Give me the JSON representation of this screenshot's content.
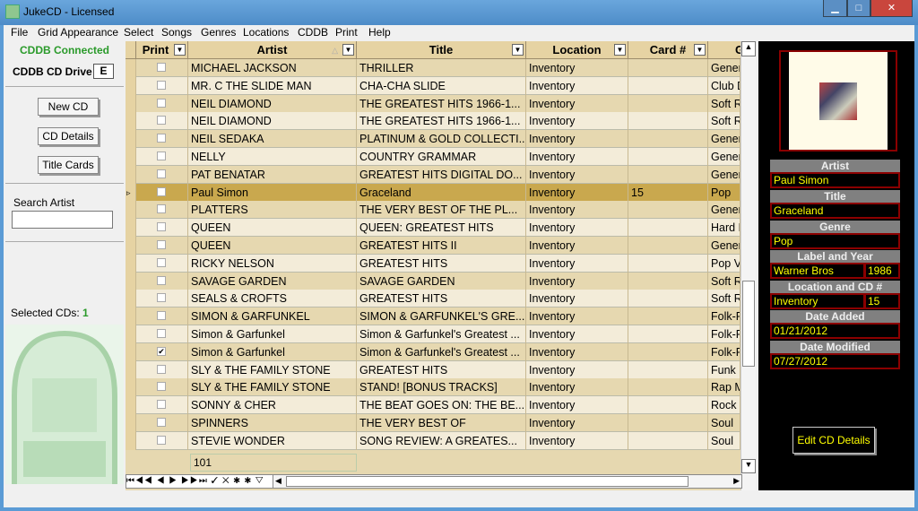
{
  "window": {
    "title": "JukeCD - Licensed",
    "min": "▁",
    "max": "□",
    "close": "✕"
  },
  "menu": [
    "File",
    "Grid Appearance",
    "Select",
    "Songs",
    "Genres",
    "Locations",
    "CDDB",
    "Print",
    "Help"
  ],
  "left": {
    "cddb_status": "CDDB Connected",
    "cd_drive_label": "CDDB CD Drive",
    "cd_drive_value": "E",
    "new_cd": "New CD",
    "cd_details": "CD Details",
    "title_cards": "Title Cards",
    "search_label": "Search Artist",
    "search_value": "",
    "selected_label": "Selected CDs:",
    "selected_count": "1"
  },
  "grid": {
    "columns": [
      "Print",
      "Artist",
      "Title",
      "Location",
      "Card #",
      "G"
    ],
    "rows": [
      {
        "print": false,
        "artist": "MICHAEL JACKSON",
        "title": "THRILLER",
        "location": "Inventory",
        "card": "",
        "genre": "Gener"
      },
      {
        "print": false,
        "artist": "MR. C THE SLIDE MAN",
        "title": "CHA-CHA SLIDE",
        "location": "Inventory",
        "card": "",
        "genre": "Club D"
      },
      {
        "print": false,
        "artist": "NEIL DIAMOND",
        "title": "THE GREATEST HITS 1966-1...",
        "location": "Inventory",
        "card": "",
        "genre": "Soft R"
      },
      {
        "print": false,
        "artist": "NEIL DIAMOND",
        "title": "THE GREATEST HITS 1966-1...",
        "location": "Inventory",
        "card": "",
        "genre": "Soft R"
      },
      {
        "print": false,
        "artist": "NEIL SEDAKA",
        "title": "PLATINUM & GOLD COLLECTI...",
        "location": "Inventory",
        "card": "",
        "genre": "Gener"
      },
      {
        "print": false,
        "artist": "NELLY",
        "title": "COUNTRY GRAMMAR",
        "location": "Inventory",
        "card": "",
        "genre": "Gener"
      },
      {
        "print": false,
        "artist": "PAT BENATAR",
        "title": "GREATEST HITS DIGITAL DO...",
        "location": "Inventory",
        "card": "",
        "genre": "Gener"
      },
      {
        "print": false,
        "artist": "Paul Simon",
        "title": "Graceland",
        "location": "Inventory",
        "card": "15",
        "genre": "Pop",
        "selected": true
      },
      {
        "print": false,
        "artist": "PLATTERS",
        "title": "THE VERY BEST OF THE PL...",
        "location": "Inventory",
        "card": "",
        "genre": "Gener"
      },
      {
        "print": false,
        "artist": "QUEEN",
        "title": "QUEEN: GREATEST HITS",
        "location": "Inventory",
        "card": "",
        "genre": "Hard R"
      },
      {
        "print": false,
        "artist": "QUEEN",
        "title": "GREATEST HITS II",
        "location": "Inventory",
        "card": "",
        "genre": "Gener"
      },
      {
        "print": false,
        "artist": "RICKY NELSON",
        "title": "GREATEST HITS",
        "location": "Inventory",
        "card": "",
        "genre": "Pop V"
      },
      {
        "print": false,
        "artist": "SAVAGE GARDEN",
        "title": "SAVAGE GARDEN",
        "location": "Inventory",
        "card": "",
        "genre": "Soft R"
      },
      {
        "print": false,
        "artist": "SEALS & CROFTS",
        "title": "GREATEST HITS",
        "location": "Inventory",
        "card": "",
        "genre": "Soft R"
      },
      {
        "print": false,
        "artist": "SIMON & GARFUNKEL",
        "title": "SIMON & GARFUNKEL'S GRE...",
        "location": "Inventory",
        "card": "",
        "genre": "Folk-R"
      },
      {
        "print": false,
        "artist": "Simon & Garfunkel",
        "title": "Simon & Garfunkel's Greatest ...",
        "location": "Inventory",
        "card": "",
        "genre": "Folk-R"
      },
      {
        "print": true,
        "artist": "Simon & Garfunkel",
        "title": "Simon & Garfunkel's Greatest ...",
        "location": "Inventory",
        "card": "",
        "genre": "Folk-R"
      },
      {
        "print": false,
        "artist": "SLY & THE FAMILY STONE",
        "title": "GREATEST HITS",
        "location": "Inventory",
        "card": "",
        "genre": "Funk"
      },
      {
        "print": false,
        "artist": "SLY & THE FAMILY STONE",
        "title": "STAND! [BONUS TRACKS]",
        "location": "Inventory",
        "card": "",
        "genre": "Rap M"
      },
      {
        "print": false,
        "artist": "SONNY & CHER",
        "title": "THE BEAT GOES ON: THE BE...",
        "location": "Inventory",
        "card": "",
        "genre": "Rock"
      },
      {
        "print": false,
        "artist": "SPINNERS",
        "title": "THE VERY BEST OF",
        "location": "Inventory",
        "card": "",
        "genre": "Soul"
      },
      {
        "print": false,
        "artist": "STEVIE WONDER",
        "title": "SONG REVIEW: A GREATES...",
        "location": "Inventory",
        "card": "",
        "genre": "Soul"
      }
    ],
    "footer_count": "101",
    "nav": "⏮◀◀ ◀ ▶ ▶▶⏭ ✓ ✕ ✱ ✱ ▽"
  },
  "details": {
    "artist_label": "Artist",
    "artist": "Paul Simon",
    "title_label": "Title",
    "title": "Graceland",
    "genre_label": "Genre",
    "genre": "Pop",
    "label_year_label": "Label and Year",
    "label": "Warner Bros",
    "year": "1986",
    "location_label": "Location and CD #",
    "location": "Inventory",
    "cd_num": "15",
    "date_added_label": "Date Added",
    "date_added": "01/21/2012",
    "date_modified_label": "Date Modified",
    "date_modified": "07/27/2012",
    "edit_button": "Edit CD Details"
  },
  "colors": {
    "row_odd": "#e6d8b0",
    "row_even": "#f3ecd9",
    "row_selected": "#c9a84e",
    "detail_text": "#ffff00",
    "cddb_status": "#2a9a2a"
  }
}
